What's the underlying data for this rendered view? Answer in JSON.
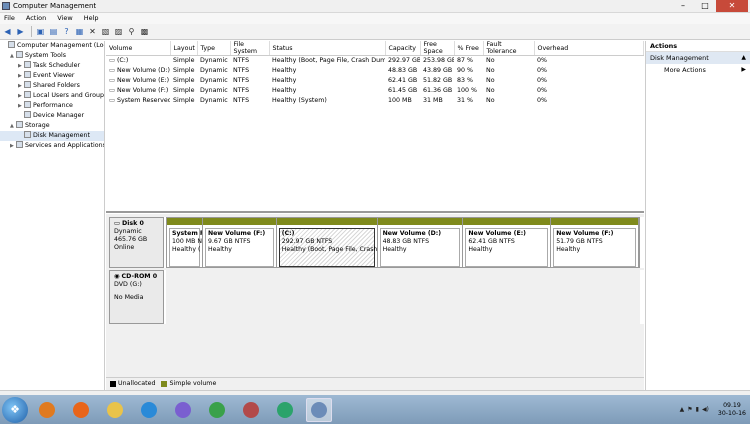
{
  "window": {
    "title": "Computer Management",
    "min": "–",
    "max": "□",
    "close": "✕"
  },
  "menu": [
    "File",
    "Action",
    "View",
    "Help"
  ],
  "toolbar": [
    "back-icon",
    "forward-icon",
    "up-icon",
    "properties-icon",
    "help-icon",
    "view-icon",
    "delete-icon",
    "settings-icon",
    "open-icon",
    "search-icon",
    "folder-icon"
  ],
  "tree": [
    {
      "label": "Computer Management (Local",
      "indent": 0,
      "exp": ""
    },
    {
      "label": "System Tools",
      "indent": 1,
      "exp": "▲"
    },
    {
      "label": "Task Scheduler",
      "indent": 2,
      "exp": "▶"
    },
    {
      "label": "Event Viewer",
      "indent": 2,
      "exp": "▶"
    },
    {
      "label": "Shared Folders",
      "indent": 2,
      "exp": "▶"
    },
    {
      "label": "Local Users and Groups",
      "indent": 2,
      "exp": "▶"
    },
    {
      "label": "Performance",
      "indent": 2,
      "exp": "▶"
    },
    {
      "label": "Device Manager",
      "indent": 2,
      "exp": ""
    },
    {
      "label": "Storage",
      "indent": 1,
      "exp": "▲"
    },
    {
      "label": "Disk Management",
      "indent": 2,
      "exp": "",
      "selected": true
    },
    {
      "label": "Services and Applications",
      "indent": 1,
      "exp": "▶"
    }
  ],
  "columns": [
    "Volume",
    "Layout",
    "Type",
    "File System",
    "Status",
    "Capacity",
    "Free Space",
    "% Free",
    "Fault Tolerance",
    "Overhead"
  ],
  "volumes": [
    [
      "(C:)",
      "Simple",
      "Dynamic",
      "NTFS",
      "Healthy (Boot, Page File, Crash Dump)",
      "292.97 GB",
      "253.98 GB",
      "87 %",
      "No",
      "0%"
    ],
    [
      "New Volume (D:)",
      "Simple",
      "Dynamic",
      "NTFS",
      "Healthy",
      "48.83 GB",
      "43.89 GB",
      "90 %",
      "No",
      "0%"
    ],
    [
      "New Volume (E:)",
      "Simple",
      "Dynamic",
      "NTFS",
      "Healthy",
      "62.41 GB",
      "51.82 GB",
      "83 %",
      "No",
      "0%"
    ],
    [
      "New Volume (F:)",
      "Simple",
      "Dynamic",
      "NTFS",
      "Healthy",
      "61.45 GB",
      "61.36 GB",
      "100 %",
      "No",
      "0%"
    ],
    [
      "System Reserved",
      "Simple",
      "Dynamic",
      "NTFS",
      "Healthy (System)",
      "100 MB",
      "31 MB",
      "31 %",
      "No",
      "0%"
    ]
  ],
  "disk0": {
    "name": "Disk 0",
    "type": "Dynamic",
    "size": "465.76 GB",
    "state": "Online",
    "partitions": [
      {
        "name": "System R",
        "size": "100 MB N",
        "status": "Healthy (",
        "w": 36
      },
      {
        "name": "New Volume  (F:)",
        "size": "9.67 GB NTFS",
        "status": "Healthy",
        "w": 74
      },
      {
        "name": "(C:)",
        "size": "292.97 GB NTFS",
        "status": "Healthy (Boot, Page File, Crash D",
        "w": 101,
        "hatch": true
      },
      {
        "name": "New Volume  (D:)",
        "size": "48.83 GB NTFS",
        "status": "Healthy",
        "w": 86
      },
      {
        "name": "New Volume  (E:)",
        "size": "62.41 GB NTFS",
        "status": "Healthy",
        "w": 88
      },
      {
        "name": "New Volume  (F:)",
        "size": "51.79 GB NTFS",
        "status": "Healthy",
        "w": 88
      }
    ]
  },
  "cdrom": {
    "name": "CD-ROM 0",
    "drive": "DVD (G:)",
    "media": "No Media"
  },
  "legend": {
    "unallocated": "Unallocated",
    "simple": "Simple volume",
    "unallocated_color": "#000000",
    "simple_color": "#7f8a1c"
  },
  "actions": {
    "header": "Actions",
    "section": "Disk Management",
    "more": "More Actions",
    "section_arrow": "▲",
    "more_arrow": "▶"
  },
  "taskbar": {
    "apps": [
      {
        "name": "media-player-icon",
        "color": "#e07a1f"
      },
      {
        "name": "firefox-icon",
        "color": "#e8651a"
      },
      {
        "name": "explorer-icon",
        "color": "#e9c34a"
      },
      {
        "name": "ie-icon",
        "color": "#2a8ad8"
      },
      {
        "name": "skype-icon",
        "color": "#7a5fd0"
      },
      {
        "name": "chrome-icon",
        "color": "#3aa14a"
      },
      {
        "name": "winrar-icon",
        "color": "#b24a4a"
      },
      {
        "name": "idm-icon",
        "color": "#2ba36b"
      },
      {
        "name": "computer-management-icon",
        "color": "#6b8cb8",
        "active": true
      }
    ],
    "tray_time": "09.19",
    "tray_date": "30-10-16"
  }
}
